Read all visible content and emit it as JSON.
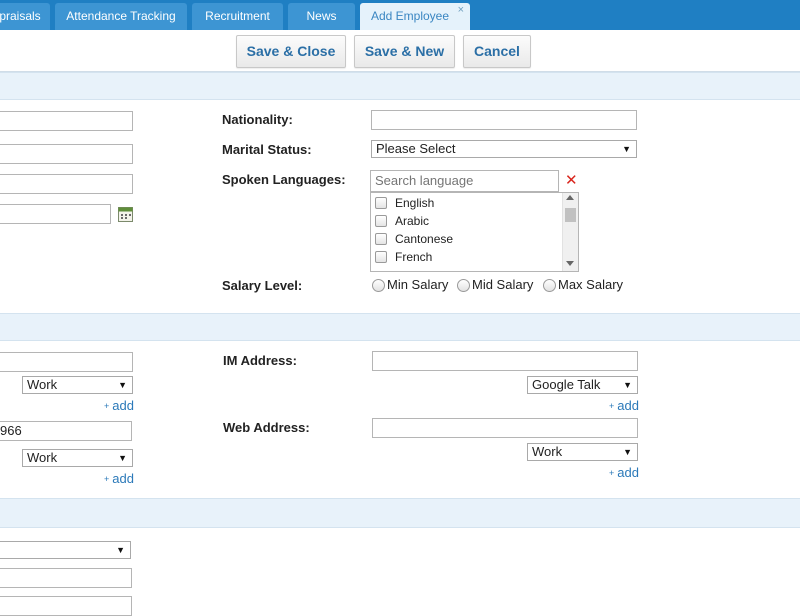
{
  "tabs": [
    {
      "label": "praisals"
    },
    {
      "label": "Attendance Tracking"
    },
    {
      "label": "Recruitment"
    },
    {
      "label": "News"
    },
    {
      "label": "Add Employee",
      "close": "×"
    }
  ],
  "toolbar": {
    "save_close_label": "Save & Close",
    "save_new_label": "Save & New",
    "cancel_label": "Cancel"
  },
  "details": {
    "nationality_label": "Nationality:",
    "nationality_value": "",
    "marital_status_label": "Marital Status:",
    "marital_status_value": "Please Select",
    "spoken_languages_label": "Spoken Languages:",
    "language_search_placeholder": "Search language",
    "languages": [
      "English",
      "Arabic",
      "Cantonese",
      "French"
    ],
    "salary_level_label": "Salary Level:",
    "salary_options": [
      "Min Salary",
      "Mid Salary",
      "Max Salary"
    ]
  },
  "contact": {
    "left_type_1": "Work",
    "add_label": "add",
    "left_field_2_value": "966",
    "left_type_2": "Work",
    "im_label": "IM Address:",
    "im_value": "",
    "im_type": "Google Talk",
    "web_label": "Web Address:",
    "web_value": "",
    "web_type": "Work"
  },
  "icons": {
    "calendar": "calendar-icon",
    "clear": "clear-icon",
    "dropdown": "▼",
    "clear_glyph": "✕",
    "plus": "+"
  },
  "colors": {
    "topbar": "#1f7fc3",
    "tab": "#3d95d3",
    "active_tab": "#e5f2fb",
    "accent_text": "#2b6fa6",
    "section_band": "#e8f2fa",
    "clear_icon": "#d9251c"
  }
}
